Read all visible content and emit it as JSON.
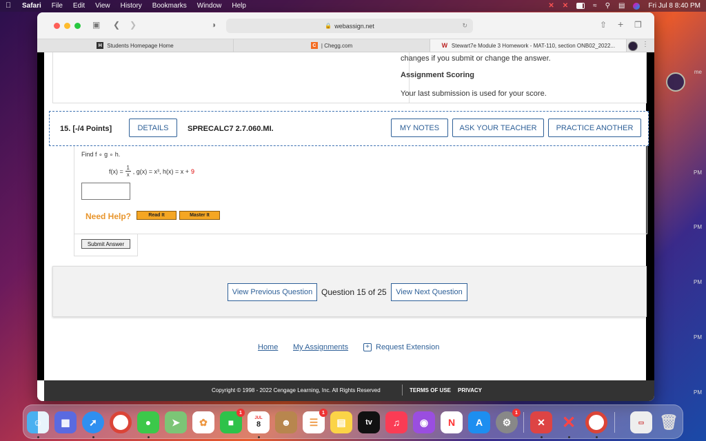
{
  "menubar": {
    "app": "Safari",
    "items": [
      "File",
      "Edit",
      "View",
      "History",
      "Bookmarks",
      "Window",
      "Help"
    ],
    "datetime": "Fri Jul 8  8:40 PM"
  },
  "side_labels": [
    "me",
    "PM",
    "PM",
    "PM",
    "PM",
    "PM"
  ],
  "browser": {
    "url": "webassign.net",
    "tabs": [
      {
        "label": "Students Homepage Home"
      },
      {
        "label": "| Chegg.com"
      },
      {
        "label": "Stewart7e Module 3 Homework - MAT-110, section ONB02_2022..."
      }
    ]
  },
  "previous": {
    "text1": "changes if you submit or change the answer.",
    "scoring_title": "Assignment Scoring",
    "scoring_text": "Your last submission is used for your score."
  },
  "question": {
    "number": "15.  [-/4 Points]",
    "details": "DETAILS",
    "code": "SPRECALC7 2.7.060.MI.",
    "my_notes": "MY NOTES",
    "ask_teacher": "ASK YOUR TEACHER",
    "practice": "PRACTICE ANOTHER",
    "find": "Find  f ∘ g ∘ h.",
    "f_left": "f(x) =",
    "f_num": "1",
    "f_den": "x",
    "g": ",   g(x) = x³,   h(x) = x +",
    "h_const": "9",
    "need_help": "Need Help?",
    "read_it": "Read It",
    "master_it": "Master It",
    "submit": "Submit Answer"
  },
  "navigation": {
    "prev": "View Previous Question",
    "count": "Question 15 of 25",
    "next": "View Next Question"
  },
  "footer": {
    "home": "Home",
    "assignments": "My Assignments",
    "extension": "Request Extension",
    "copyright": "Copyright © 1998 - 2022 Cengage Learning, Inc. All Rights Reserved",
    "terms": "TERMS OF USE",
    "privacy": "PRIVACY"
  },
  "dock": {
    "calendar_month": "JUL",
    "calendar_day": "8",
    "tv_label": "tv",
    "badges": {
      "facetime": "1",
      "reminders": "1",
      "settings": "1"
    }
  }
}
